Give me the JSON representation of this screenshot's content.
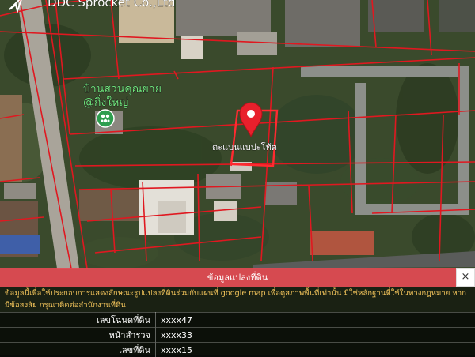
{
  "map": {
    "labels": {
      "company": "DDC Sprocket Co.,Ltd",
      "place_line1": "บ้านสวนคุณยาย",
      "place_line2": "@กิ่งใหญ่",
      "parcel": "ตะแบนแบปะโท้ต"
    },
    "icons": [
      "navigation-icon",
      "location-pin-icon",
      "place-marker-icon"
    ]
  },
  "panel": {
    "title": "ข้อมูลแปลงที่ดิน",
    "close_label": "×",
    "notice": "ข้อมูลนี้เพื่อใช้ประกอบการแสดงลักษณะรูปแปลงที่ดินร่วมกับแผนที่ google map เพื่อดูสภาพพื้นที่เท่านั้น มิใช่หลักฐานที่ใช้ในทางกฎหมาย หากมีข้อสงสัย กรุณาติดต่อสำนักงานที่ดิน",
    "rows": [
      {
        "label": "เลขโฉนดที่ดิน",
        "value": "xxxx47"
      },
      {
        "label": "หน้าสำรวจ",
        "value": "xxxx33"
      },
      {
        "label": "เลขที่ดิน",
        "value": "xxxx15"
      }
    ]
  },
  "colors": {
    "header": "#e44a54",
    "notice_text": "#f0c25a",
    "parcel_lines": "#e01820",
    "pin": "#e8202c"
  }
}
